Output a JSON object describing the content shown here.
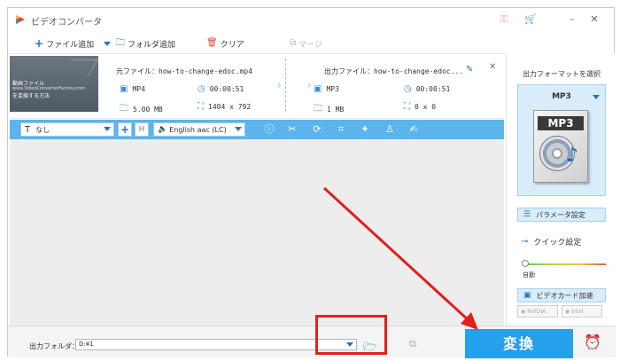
{
  "app": {
    "title": "ビデオコンバータ"
  },
  "toolbar": {
    "add_file": "ファイル追加",
    "add_folder": "フォルダ追加",
    "clear": "クリア",
    "merge": "マージ"
  },
  "file": {
    "source_label": "元ファイル：",
    "source_name": "how-to-change-edoc.mp4",
    "source_format": "MP4",
    "source_duration": "00:00:51",
    "source_size": "5.00 MB",
    "source_resolution": "1404 x 792",
    "output_label": "出力ファイル：",
    "output_name": "how-to-change-edoc...",
    "output_format": "MP3",
    "output_duration": "00:00:51",
    "output_size": "1 MB",
    "output_resolution": "0 x 0",
    "thumb_line1": "動画ファイル",
    "thumb_line2": "www.VideoConverterFactory.com",
    "thumb_line3": "を変換する方法"
  },
  "editbar": {
    "subtitle": "なし",
    "audio_track": "English aac (LC)"
  },
  "bottom": {
    "output_folder_label": "出力フォルダ：",
    "output_path": "D:¥1",
    "convert": "変換"
  },
  "sidebar": {
    "title": "出力フォーマットを選択",
    "format": "MP3",
    "format_image_text": "MP3",
    "param_settings": "パラメータ設定",
    "quick_settings": "クイック設定",
    "slider_label": "自動",
    "gpu_accel": "ビデオカード加速",
    "gpu_nvidia": "NVIDIA",
    "gpu_intel": "Intel"
  },
  "colors": {
    "accent": "#25a0ea",
    "editbar": "#5bb4ec",
    "annotation_red": "#e0201e"
  }
}
